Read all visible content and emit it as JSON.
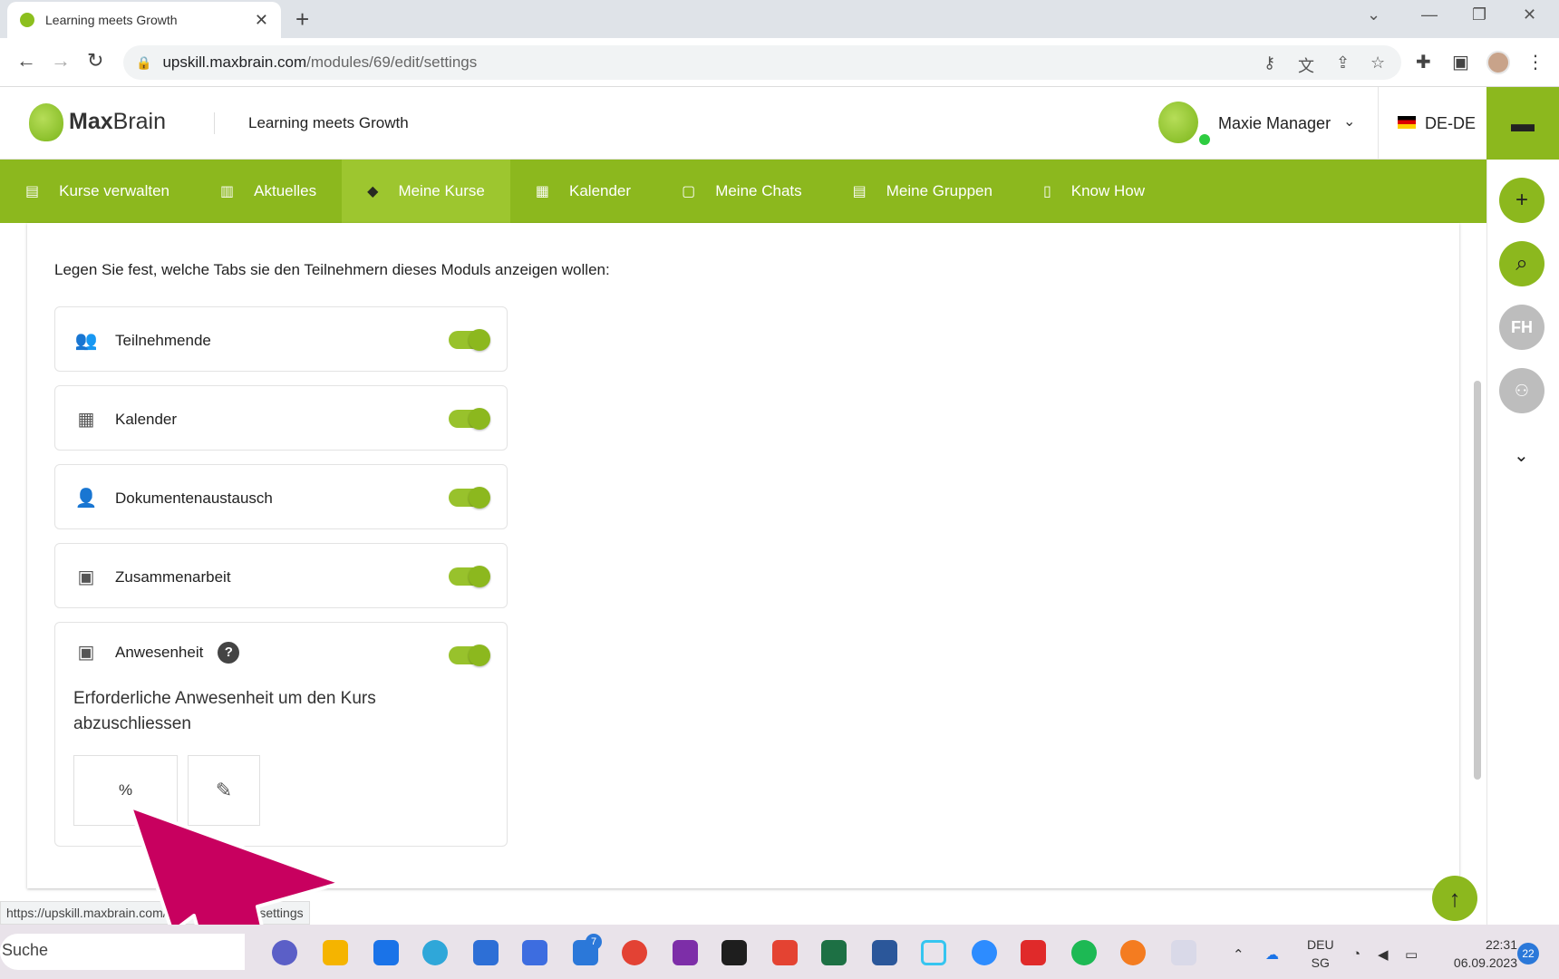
{
  "browser": {
    "tab_title": "Learning meets Growth",
    "url_domain": "upskill.maxbrain.com",
    "url_path": "/modules/69/edit/settings",
    "status_url": "https://upskill.maxbrain.com/modules/69/edit/settings"
  },
  "header": {
    "logo_bold": "Max",
    "logo_light": "Brain",
    "title": "Learning meets Growth",
    "user_name": "Maxie Manager",
    "language": "DE-DE"
  },
  "nav": {
    "items": [
      {
        "label": "Kurse verwalten",
        "icon": "id-card-icon"
      },
      {
        "label": "Aktuelles",
        "icon": "news-icon"
      },
      {
        "label": "Meine Kurse",
        "icon": "graduation-cap-icon"
      },
      {
        "label": "Kalender",
        "icon": "calendar-icon"
      },
      {
        "label": "Meine Chats",
        "icon": "chat-icon"
      },
      {
        "label": "Meine Gruppen",
        "icon": "group-card-icon"
      },
      {
        "label": "Know How",
        "icon": "book-icon"
      }
    ],
    "active_index": 2
  },
  "sidebar": {
    "user_initials": "FH"
  },
  "settings": {
    "intro": "Legen Sie fest, welche Tabs sie den Teilnehmern dieses Moduls anzeigen wollen:",
    "options": [
      {
        "label": "Teilnehmende",
        "icon": "people-icon",
        "enabled": true
      },
      {
        "label": "Kalender",
        "icon": "calendar-icon",
        "enabled": true
      },
      {
        "label": "Dokumentenaustausch",
        "icon": "person-document-icon",
        "enabled": true
      },
      {
        "label": "Zusammenarbeit",
        "icon": "contact-folder-icon",
        "enabled": true
      },
      {
        "label": "Anwesenheit",
        "icon": "contact-folder-icon",
        "enabled": true
      }
    ],
    "attendance_required_label": "Erforderliche Anwesenheit um den Kurs abzuschliessen",
    "attendance_unit": "%"
  },
  "taskbar": {
    "search_placeholder": "Suche",
    "badge_count": "7",
    "lang_top": "DEU",
    "lang_bottom": "SG",
    "time": "22:31",
    "date": "06.09.2023",
    "notifications": "22"
  },
  "colors": {
    "brand_green": "#8cb81e",
    "arrow_pink": "#c8005f"
  }
}
